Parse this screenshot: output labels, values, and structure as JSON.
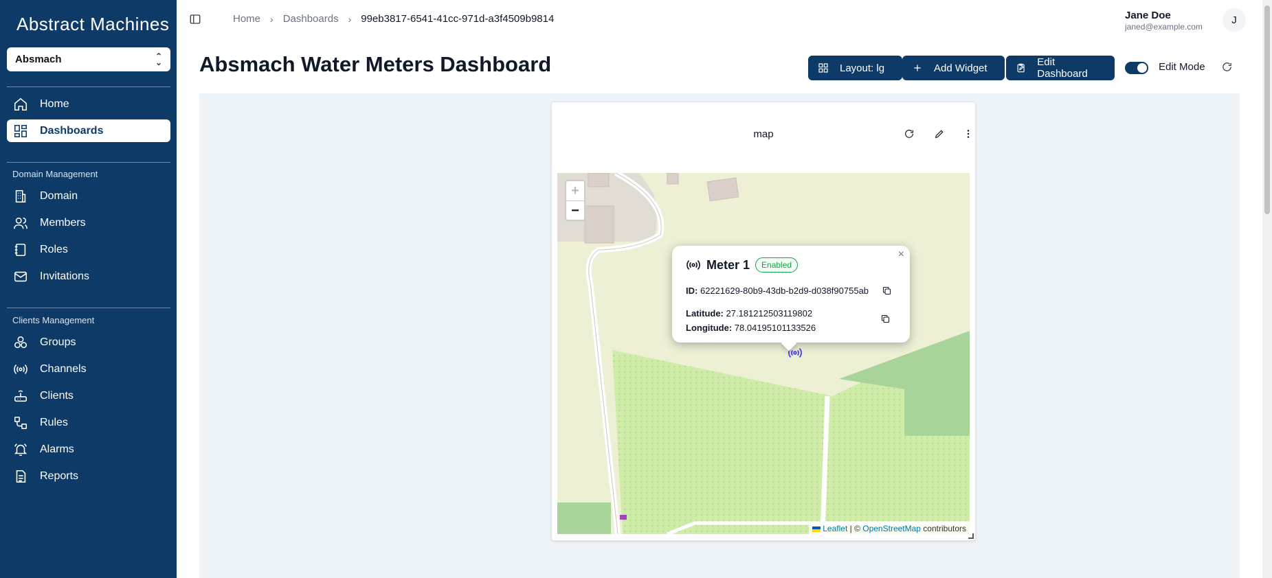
{
  "app": {
    "logo": "Abstract Machines"
  },
  "sidebar": {
    "org": "Absmach",
    "top_items": [
      {
        "label": "Home",
        "icon": "home-icon"
      },
      {
        "label": "Dashboards",
        "icon": "dashboard-icon",
        "active": true
      }
    ],
    "domain_section": "Domain Management",
    "domain_items": [
      {
        "label": "Domain",
        "icon": "building-icon"
      },
      {
        "label": "Members",
        "icon": "users-icon"
      },
      {
        "label": "Roles",
        "icon": "book-icon"
      },
      {
        "label": "Invitations",
        "icon": "mail-icon"
      }
    ],
    "clients_section": "Clients Management",
    "clients_items": [
      {
        "label": "Groups",
        "icon": "groups-icon"
      },
      {
        "label": "Channels",
        "icon": "radio-icon"
      },
      {
        "label": "Clients",
        "icon": "router-icon"
      },
      {
        "label": "Rules",
        "icon": "workflow-icon"
      },
      {
        "label": "Alarms",
        "icon": "bell-icon"
      },
      {
        "label": "Reports",
        "icon": "report-icon"
      }
    ]
  },
  "header": {
    "breadcrumbs": [
      "Home",
      "Dashboards",
      "99eb3817-6541-41cc-971d-a3f4509b9814"
    ],
    "user_name": "Jane Doe",
    "user_email": "janed@example.com",
    "avatar_initial": "J"
  },
  "page": {
    "title": "Absmach Water Meters Dashboard",
    "buttons": {
      "layout": "Layout: lg",
      "add_widget": "Add Widget",
      "edit_dashboard": "Edit Dashboard"
    },
    "edit_mode_label": "Edit Mode",
    "edit_mode_on": true
  },
  "widget": {
    "title": "map",
    "zoom_in": "+",
    "zoom_out": "−",
    "attribution": {
      "leaflet": "Leaflet",
      "sep": " | © ",
      "osm": "OpenStreetMap",
      "suffix": " contributors"
    },
    "popup": {
      "close": "×",
      "name": "Meter 1",
      "status": "Enabled",
      "id_label": "ID:",
      "id": "62221629-80b9-43db-b2d9-d038f90755ab",
      "lat_label": "Latitude:",
      "lat": "27.181212503119802",
      "lon_label": "Longitude:",
      "lon": "78.04195101133526"
    }
  },
  "colors": {
    "sidebar_bg": "#0d3a66",
    "primary": "#0d3a66",
    "enabled": "#16a34a",
    "marker": "#4f46e5"
  }
}
